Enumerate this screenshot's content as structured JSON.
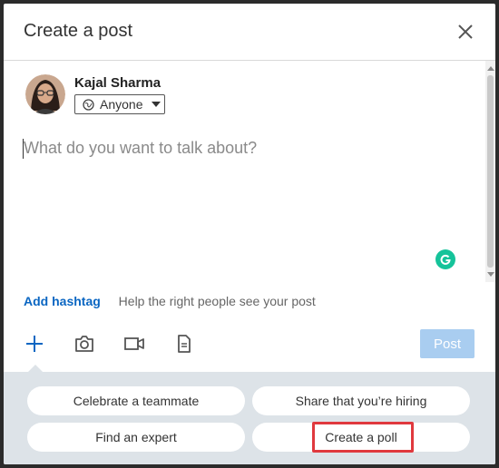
{
  "dialog": {
    "title": "Create a post",
    "close_icon": "close-icon"
  },
  "author": {
    "name": "Kajal Sharma",
    "avatar_icon": "avatar",
    "visibility": {
      "label": "Anyone",
      "icon": "globe-icon",
      "caret_icon": "caret-down-icon"
    }
  },
  "editor": {
    "placeholder": "What do you want to talk about?",
    "grammarly_icon": "grammarly-icon"
  },
  "hashtag": {
    "link_label": "Add hashtag",
    "help_text": "Help the right people see your post"
  },
  "toolbar": {
    "icons": [
      "plus-icon",
      "camera-icon",
      "video-icon",
      "document-icon"
    ],
    "post_label": "Post"
  },
  "suggestions": {
    "items": [
      {
        "label": "Celebrate a teammate"
      },
      {
        "label": "Share that you’re hiring"
      },
      {
        "label": "Find an expert"
      },
      {
        "label": "Create a poll",
        "highlighted": true
      }
    ]
  },
  "colors": {
    "accent": "#0a66c2",
    "post_disabled": "#a9cdf0",
    "tray": "#dde3e8",
    "highlight": "#e0393e",
    "grammarly": "#15c39a"
  }
}
